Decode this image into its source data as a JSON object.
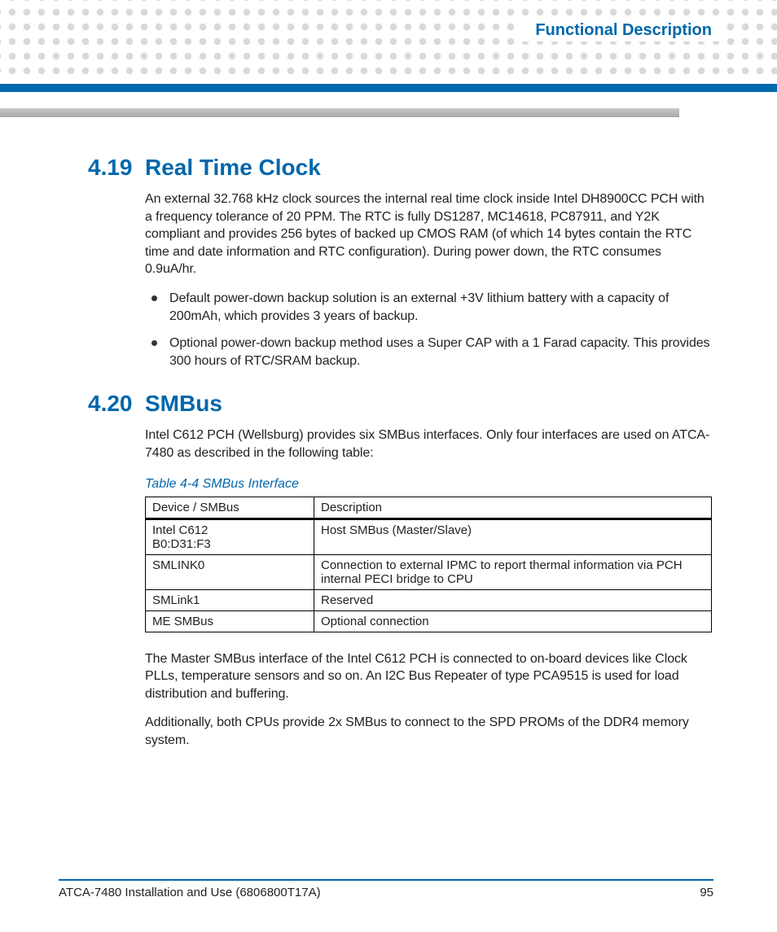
{
  "header": {
    "running_title": "Functional Description"
  },
  "sections": {
    "rtc": {
      "number": "4.19",
      "title": "Real Time Clock",
      "paragraph": "An external 32.768 kHz clock sources the internal real time clock inside Intel DH8900CC PCH with a frequency tolerance of 20 PPM. The RTC is fully DS1287, MC14618, PC87911, and Y2K compliant and provides 256 bytes of backed up CMOS RAM (of which 14 bytes contain the RTC time and date information and RTC configuration). During power down, the RTC consumes 0.9uA/hr.",
      "bullets": [
        "Default power-down backup solution is an external +3V lithium battery with a capacity of 200mAh, which provides 3 years of backup.",
        "Optional power-down backup method uses a Super CAP with a 1 Farad capacity. This provides 300 hours of RTC/SRAM backup."
      ]
    },
    "smbus": {
      "number": "4.20",
      "title": "SMBus",
      "intro": "Intel C612 PCH (Wellsburg) provides six SMBus interfaces. Only four interfaces are used on ATCA-7480 as described in the following table:",
      "table_caption": "Table 4-4 SMBus Interface",
      "table_headers": {
        "col1": "Device / SMBus",
        "col2": "Description"
      },
      "table_rows": [
        {
          "device": "Intel C612\nB0:D31:F3",
          "desc": "Host SMBus (Master/Slave)"
        },
        {
          "device": "SMLINK0",
          "desc": "Connection to external IPMC to report thermal information via PCH internal PECI bridge to CPU"
        },
        {
          "device": "SMLink1",
          "desc": "Reserved"
        },
        {
          "device": "ME SMBus",
          "desc": "Optional connection"
        }
      ],
      "after_paragraphs": [
        "The Master SMBus interface of the Intel C612 PCH is connected to on-board devices like Clock PLLs, temperature sensors and so on. An I2C Bus Repeater of type PCA9515 is used for load distribution and buffering.",
        "Additionally, both CPUs provide 2x SMBus to connect to the SPD PROMs of the DDR4 memory system."
      ]
    }
  },
  "footer": {
    "doc_title": "ATCA-7480 Installation and Use (6806800T17A)",
    "page_number": "95"
  }
}
